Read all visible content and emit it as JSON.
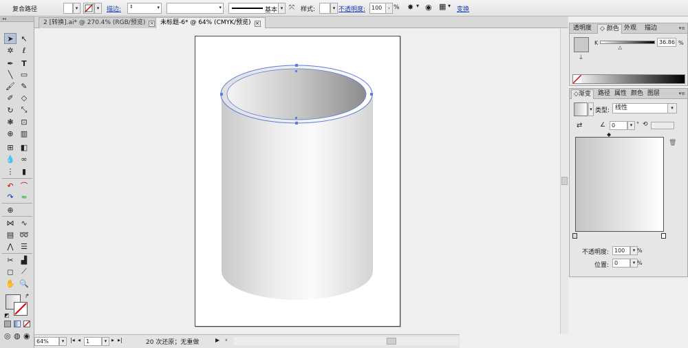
{
  "control_bar": {
    "selection_label": "复合路径",
    "stroke_label": "描边:",
    "stroke_profile": "基本",
    "style_label": "样式:",
    "opacity_label": "不透明度:",
    "opacity_value": "100",
    "opacity_unit": "%",
    "transform_label": "变换"
  },
  "doc_tabs": [
    {
      "label": "2 [转换].ai* @ 270.4% (RGB/预览)",
      "active": false
    },
    {
      "label": "未标题-6* @ 64% (CMYK/预览)",
      "active": true
    }
  ],
  "status_bar": {
    "zoom": "64%",
    "artboard_number": "1",
    "undo_status": "20 次还原；无重做"
  },
  "color_panel": {
    "tabs": [
      "透明度",
      "颜色",
      "外观",
      "描边"
    ],
    "active_tab": "颜色",
    "channel_label": "K",
    "channel_value": "36.86",
    "channel_unit": "%",
    "channel_level": 0.3686,
    "swatch_color": "#c9c9c9"
  },
  "gradient_panel": {
    "tabs": [
      "渐变",
      "路径",
      "属性",
      "颜色",
      "图层"
    ],
    "active_tab": "渐变",
    "type_label": "类型:",
    "type_value": "线性",
    "angle_value": "0",
    "angle_unit": "°",
    "opacity_label": "不透明度:",
    "opacity_value": "100",
    "opacity_unit": "%",
    "location_label": "位置:",
    "location_value": "0",
    "location_unit": "%",
    "gradient_start": "#c4c4c4",
    "gradient_end": "#ffffff"
  },
  "colors": {
    "accent_link": "#1a3fb5",
    "selection_blue": "#5a7be0"
  }
}
